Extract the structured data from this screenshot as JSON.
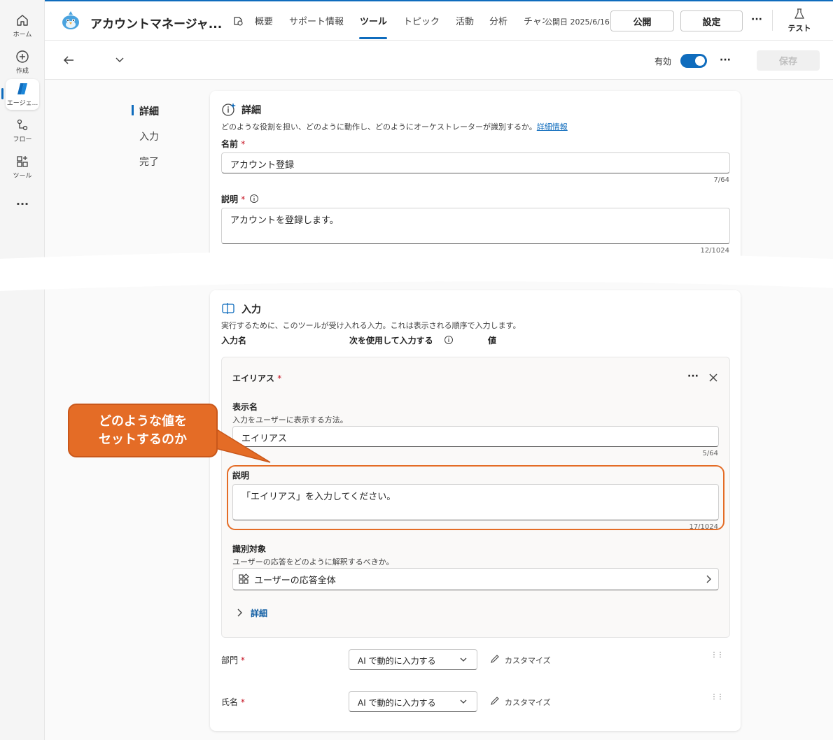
{
  "rail": {
    "home": "ホーム",
    "create": "作成",
    "agent": "エージェ...",
    "flow": "フロー",
    "tools": "ツール"
  },
  "header": {
    "agent_title": "アカウントマネージャ...",
    "tabs": [
      "概要",
      "サポート情報",
      "ツール",
      "トピック",
      "活動",
      "分析",
      "チャネル"
    ],
    "active_tab": "ツール",
    "saved_text": "公開日 2025/6/16",
    "publish_label": "公開",
    "settings_label": "設定",
    "test_label": "テスト"
  },
  "subbar": {
    "enabled_label": "有効",
    "save_label": "保存"
  },
  "side_nav": [
    "詳細",
    "入力",
    "完了"
  ],
  "details": {
    "title": "詳細",
    "description": "どのような役割を担い、どのように動作し、どのようにオーケストレーターが識別するか。",
    "learn_more": "詳細情報",
    "name_label": "名前",
    "name_value": "アカウント登録",
    "name_count": "7/64",
    "desc_label": "説明",
    "desc_value": "アカウントを登録します。",
    "desc_count": "12/1024"
  },
  "inputs": {
    "title": "入力",
    "description": "実行するために、このツールが受け入れる入力。これは表示される順序で入力します。",
    "col_name": "入力名",
    "col_use": "次を使用して入力する",
    "col_value": "値",
    "alias": {
      "title": "エイリアス",
      "display_label": "表示名",
      "display_hint": "入力をユーザーに表示する方法。",
      "display_value": "エイリアス",
      "display_count": "5/64",
      "desc_label": "説明",
      "desc_value": "「エイリアス」を入力してください。",
      "desc_count": "17/1024",
      "identify_label": "識別対象",
      "identify_hint": "ユーザーの応答をどのように解釈するべきか。",
      "identify_value": "ユーザーの応答全体",
      "more_label": "詳細"
    },
    "rows": [
      {
        "name": "部門",
        "mode": "AI で動的に入力する",
        "customize": "カスタマイズ"
      },
      {
        "name": "氏名",
        "mode": "AI で動的に入力する",
        "customize": "カスタマイズ"
      }
    ]
  },
  "callout": {
    "line1": "どのような値を",
    "line2": "セットするのか"
  },
  "colors": {
    "accent": "#0f6cbd",
    "callout": "#e46c26",
    "required": "#c50f1f"
  }
}
